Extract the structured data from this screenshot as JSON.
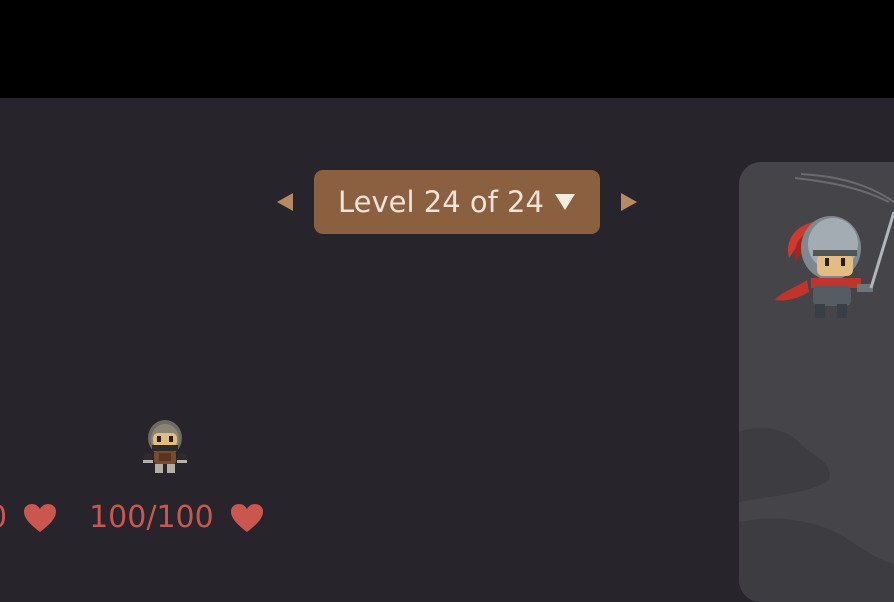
{
  "level_nav": {
    "label": "Level 24 of 24",
    "current_level": 24,
    "total_levels": 24,
    "prev_icon": "triangle-left-icon",
    "next_icon": "triangle-right-icon",
    "dropdown_icon": "caret-down-icon"
  },
  "hero": {
    "hp_left_text": "0",
    "hp_text": "100/100",
    "heart_icon": "heart-icon"
  },
  "colors": {
    "background": "#28242c",
    "top_bar": "#000000",
    "level_button": "#8a6040",
    "level_text": "#f1e4d6",
    "arrow": "#b88a64",
    "health": "#c9564f",
    "panel": "#454449"
  }
}
